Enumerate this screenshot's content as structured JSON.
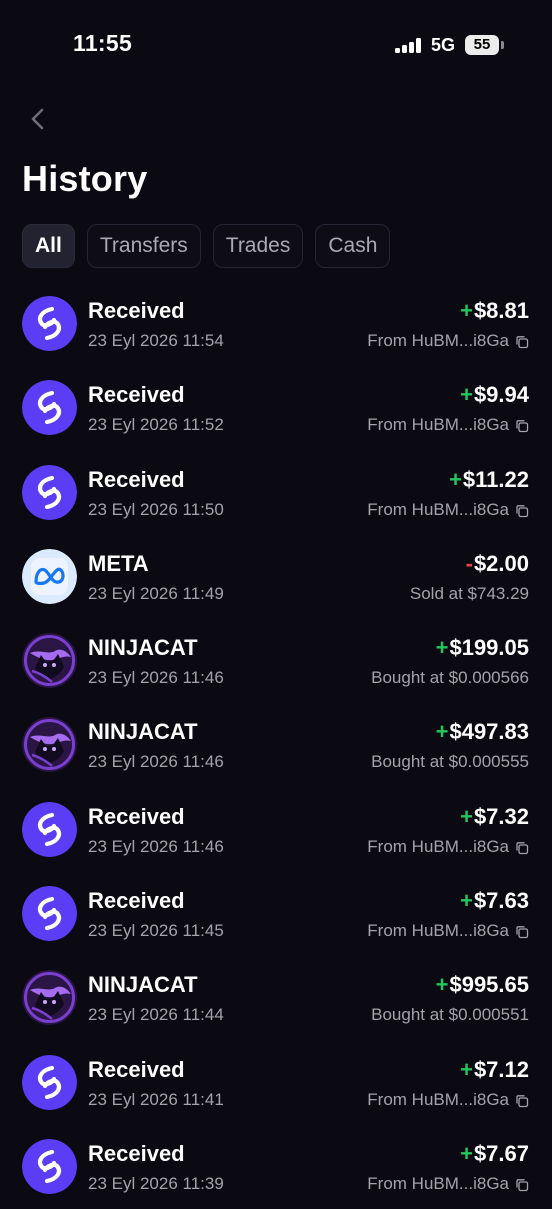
{
  "status_bar": {
    "time": "11:55",
    "network": "5G",
    "battery": "55"
  },
  "header": {
    "title": "History"
  },
  "tabs": [
    {
      "label": "All",
      "active": true
    },
    {
      "label": "Transfers",
      "active": false
    },
    {
      "label": "Trades",
      "active": false
    },
    {
      "label": "Cash",
      "active": false
    }
  ],
  "colors": {
    "positive": "#22c55e",
    "negative": "#ef4444",
    "received_icon_bg": "#5b3df5",
    "meta_icon_bg": "#dbeafe"
  },
  "transactions": [
    {
      "icon": "received-icon",
      "title": "Received",
      "date": "23 Eyl 2026 11:54",
      "sign": "+",
      "amount": "$8.81",
      "detail": "From HuBM...i8Ga",
      "copy": true
    },
    {
      "icon": "received-icon",
      "title": "Received",
      "date": "23 Eyl 2026 11:52",
      "sign": "+",
      "amount": "$9.94",
      "detail": "From HuBM...i8Ga",
      "copy": true
    },
    {
      "icon": "received-icon",
      "title": "Received",
      "date": "23 Eyl 2026 11:50",
      "sign": "+",
      "amount": "$11.22",
      "detail": "From HuBM...i8Ga",
      "copy": true
    },
    {
      "icon": "meta-logo-icon",
      "title": "META",
      "date": "23 Eyl 2026 11:49",
      "sign": "-",
      "amount": "$2.00",
      "detail": "Sold at $743.29",
      "copy": false
    },
    {
      "icon": "ninjacat-icon",
      "title": "NINJACAT",
      "date": "23 Eyl 2026 11:46",
      "sign": "+",
      "amount": "$199.05",
      "detail": "Bought at $0.000566",
      "copy": false
    },
    {
      "icon": "ninjacat-icon",
      "title": "NINJACAT",
      "date": "23 Eyl 2026 11:46",
      "sign": "+",
      "amount": "$497.83",
      "detail": "Bought at $0.000555",
      "copy": false
    },
    {
      "icon": "received-icon",
      "title": "Received",
      "date": "23 Eyl 2026 11:46",
      "sign": "+",
      "amount": "$7.32",
      "detail": "From HuBM...i8Ga",
      "copy": true
    },
    {
      "icon": "received-icon",
      "title": "Received",
      "date": "23 Eyl 2026 11:45",
      "sign": "+",
      "amount": "$7.63",
      "detail": "From HuBM...i8Ga",
      "copy": true
    },
    {
      "icon": "ninjacat-icon",
      "title": "NINJACAT",
      "date": "23 Eyl 2026 11:44",
      "sign": "+",
      "amount": "$995.65",
      "detail": "Bought at $0.000551",
      "copy": false
    },
    {
      "icon": "received-icon",
      "title": "Received",
      "date": "23 Eyl 2026 11:41",
      "sign": "+",
      "amount": "$7.12",
      "detail": "From HuBM...i8Ga",
      "copy": true
    },
    {
      "icon": "received-icon",
      "title": "Received",
      "date": "23 Eyl 2026 11:39",
      "sign": "+",
      "amount": "$7.67",
      "detail": "From HuBM...i8Ga",
      "copy": true
    }
  ]
}
